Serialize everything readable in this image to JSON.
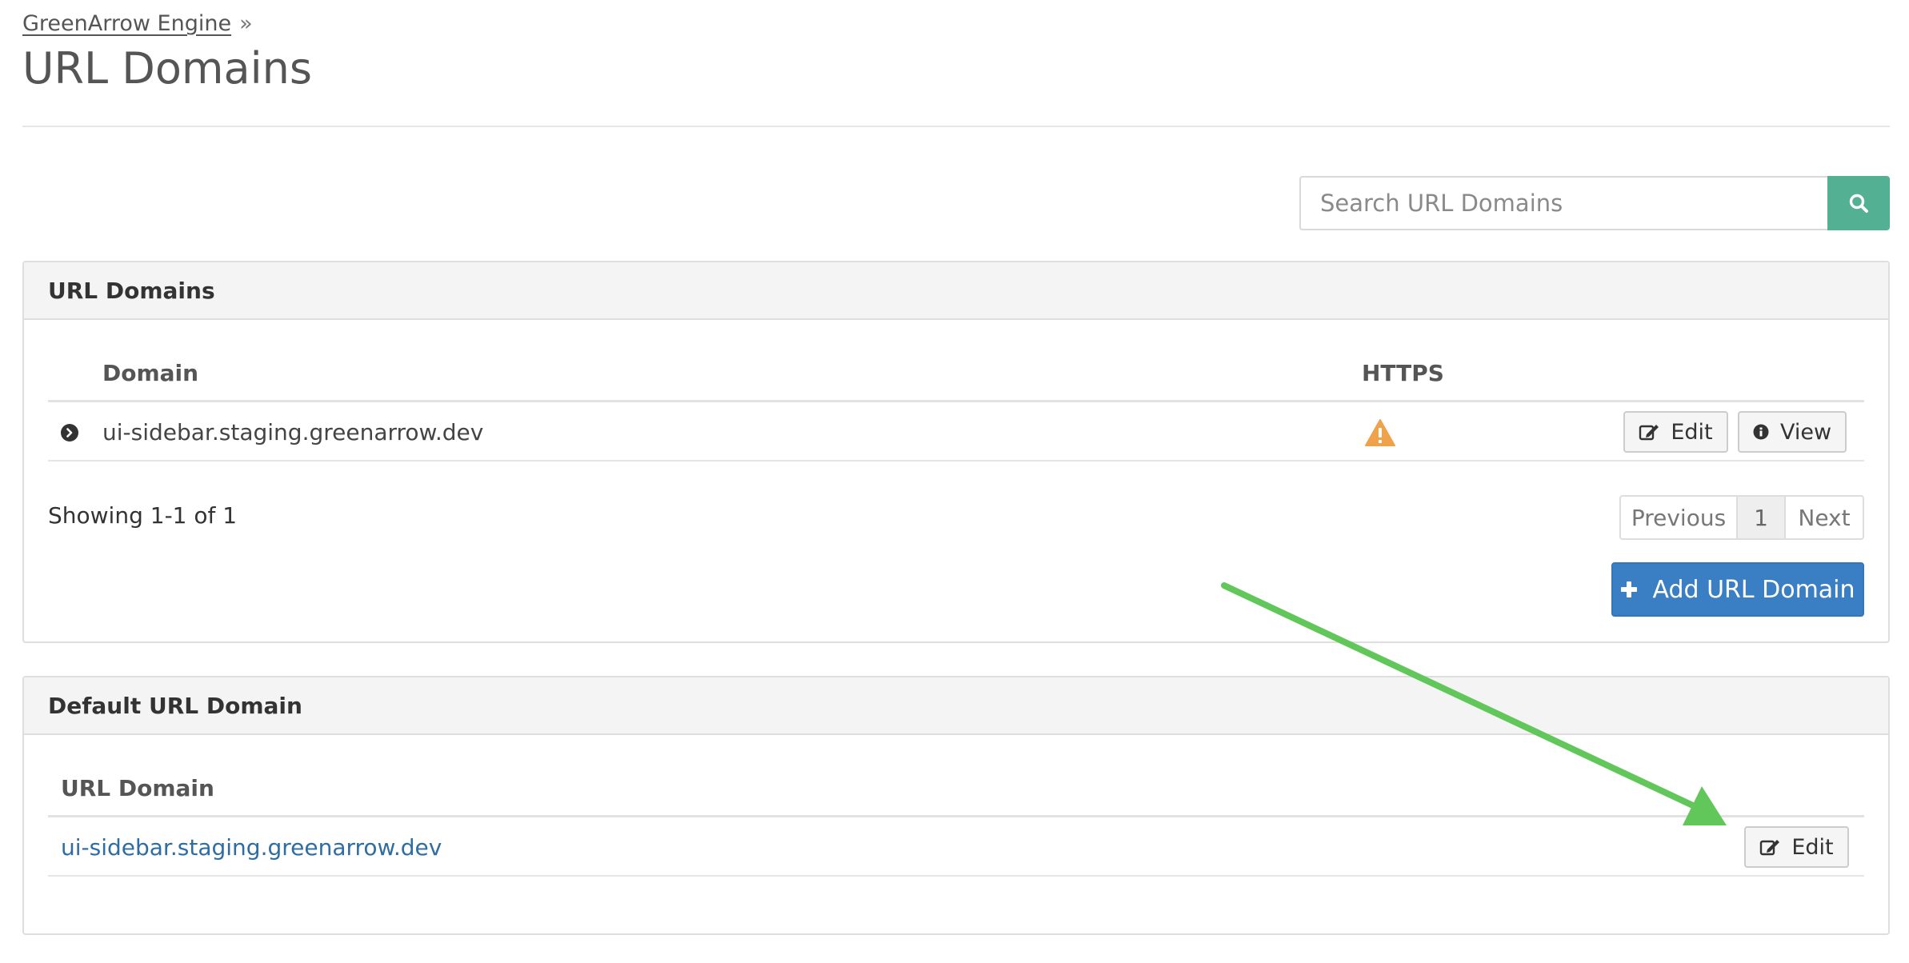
{
  "breadcrumb": {
    "parent": "GreenArrow Engine",
    "separator": "»"
  },
  "page_title": "URL Domains",
  "search": {
    "placeholder": "Search URL Domains",
    "value": "",
    "button_icon": "search-icon"
  },
  "url_domains_panel": {
    "heading": "URL Domains",
    "columns": {
      "domain": "Domain",
      "https": "HTTPS"
    },
    "rows": [
      {
        "domain": "ui-sidebar.staging.greenarrow.dev",
        "https_icon": "warning-icon",
        "edit_label": "Edit",
        "view_label": "View"
      }
    ],
    "showing": "Showing 1-1 of 1",
    "pagination": {
      "previous": "Previous",
      "current": "1",
      "next": "Next"
    },
    "add_button": "Add URL Domain"
  },
  "default_panel": {
    "heading": "Default URL Domain",
    "column": "URL Domain",
    "domain": "ui-sidebar.staging.greenarrow.dev",
    "edit_label": "Edit"
  },
  "colors": {
    "search_button": "#54b093",
    "primary_button": "#3a7fc4",
    "link": "#2e6da4",
    "warning": "#f0a24a",
    "annotation_arrow": "#62c75a"
  }
}
